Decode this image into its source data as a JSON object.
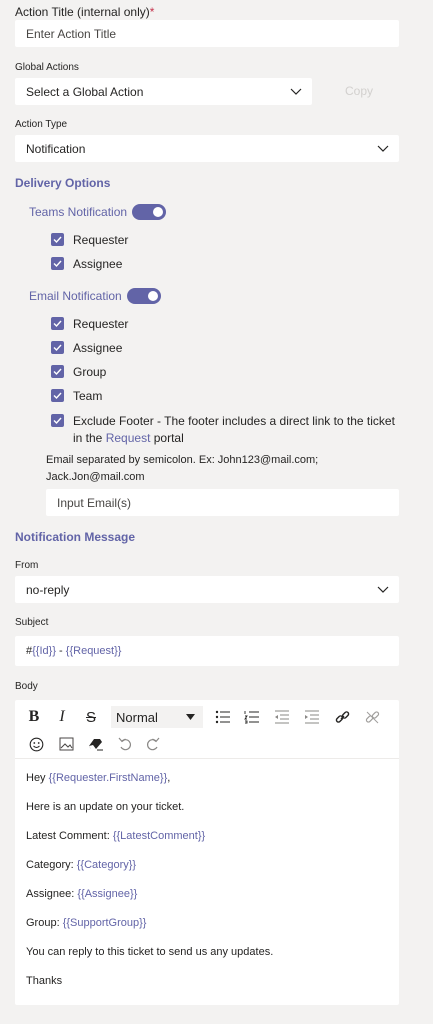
{
  "action_title": {
    "label": "Action Title (internal only)",
    "required_mark": "*",
    "placeholder": "Enter Action Title"
  },
  "global_actions": {
    "label": "Global Actions",
    "value": "Select a Global Action",
    "copy_label": "Copy"
  },
  "action_type": {
    "label": "Action Type",
    "value": "Notification"
  },
  "delivery": {
    "heading": "Delivery Options",
    "teams": {
      "label": "Teams Notification",
      "enabled": true,
      "options": [
        "Requester",
        "Assignee"
      ]
    },
    "email": {
      "label": "Email Notification",
      "enabled": true,
      "options": [
        "Requester",
        "Assignee",
        "Group",
        "Team"
      ],
      "exclude_footer_a": "Exclude Footer - The footer includes a direct link to the ticket",
      "exclude_footer_b1": "in the ",
      "exclude_footer_link": "Request",
      "exclude_footer_b2": " portal",
      "hint_line1": "Email separated by semicolon. Ex: John123@mail.com;",
      "hint_line2": "Jack.Jon@mail.com",
      "input_placeholder": "Input Email(s)"
    }
  },
  "notification": {
    "heading": "Notification Message",
    "from_label": "From",
    "from_value": "no-reply",
    "subject_label": "Subject",
    "subject_prefix": "#",
    "subject_t1": "{{Id}}",
    "subject_sep": " - ",
    "subject_t2": "{{Request}}",
    "body_label": "Body",
    "toolbar": {
      "style_value": "Normal"
    },
    "body": {
      "l1_text": "Hey ",
      "l1_tpl": "{{Requester.FirstName}}",
      "l1_end": ",",
      "l2_text": "Here is an update on your ticket.",
      "l3_text": "Latest Comment: ",
      "l3_tpl": "{{LatestComment}}",
      "l4_text": "Category: ",
      "l4_tpl": "{{Category}}",
      "l5_text": "Assignee: ",
      "l5_tpl": "{{Assignee}}",
      "l6_text": "Group: ",
      "l6_tpl": "{{SupportGroup}}",
      "l7_text": "You can reply to this ticket to send us any updates.",
      "l8_text": "Thanks"
    }
  },
  "colors": {
    "accent": "#6264a7",
    "required": "#c4314b",
    "background": "#f3f2f1"
  }
}
